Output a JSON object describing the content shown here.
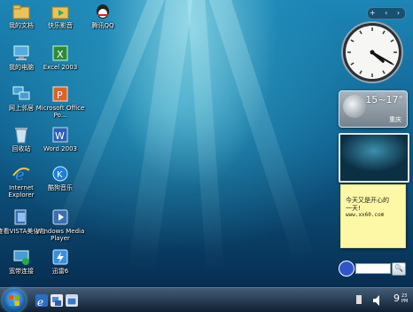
{
  "desktop_icons": [
    {
      "label": "我的文档",
      "icon": "folder-icon"
    },
    {
      "label": "我的电脑",
      "icon": "computer-icon"
    },
    {
      "label": "网上邻居",
      "icon": "network-icon"
    },
    {
      "label": "回收站",
      "icon": "recycle-bin-icon"
    },
    {
      "label": "Internet Explorer",
      "icon": "ie-icon"
    },
    {
      "label": "查看VISTA美化包",
      "icon": "vista-pack-icon"
    },
    {
      "label": "宽带连接",
      "icon": "broadband-icon"
    },
    {
      "label": "快乐影音",
      "icon": "media-folder-icon"
    },
    {
      "label": "Excel 2003",
      "icon": "excel-icon"
    },
    {
      "label": "Microsoft Office Po...",
      "icon": "powerpoint-icon"
    },
    {
      "label": "Word 2003",
      "icon": "word-icon"
    },
    {
      "label": "酷狗音乐",
      "icon": "kugou-icon"
    },
    {
      "label": "Windows Media Player",
      "icon": "media-player-icon"
    },
    {
      "label": "迅雷6",
      "icon": "thunder-icon"
    },
    {
      "label": "腾讯QQ",
      "icon": "qq-icon"
    }
  ],
  "gadgets": {
    "topbar_label": "+ ‹ ›",
    "clock": {
      "hour": 4,
      "minute": 20
    },
    "weather": {
      "temperature": "15~17°",
      "city": "重庆"
    },
    "note": {
      "line1": "今天又是开心的",
      "line2": "一天!",
      "line3": "www.xx60.com"
    },
    "search": {
      "placeholder": "",
      "button": "🔍"
    }
  },
  "taskbar": {
    "time": "9",
    "time_minutes": "23",
    "ampm": "PM"
  },
  "colors": {
    "accent": "#1d86b6",
    "taskbar": "#1a2a3d"
  }
}
